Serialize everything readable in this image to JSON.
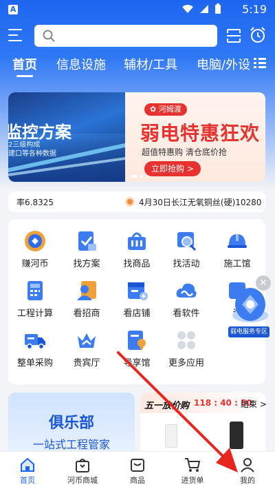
{
  "status_bar": {
    "app_badge": "A",
    "time": "5:19"
  },
  "search": {
    "placeholder": "",
    "value": ""
  },
  "tabs": [
    {
      "label": "首页",
      "active": true
    },
    {
      "label": "信息设施"
    },
    {
      "label": "辅材/工具"
    },
    {
      "label": "电脑/外设"
    }
  ],
  "banner": {
    "left_title": "监控方案",
    "left_sub_line1": "2三级构成",
    "left_sub_line2": "建口等各种数据",
    "brand": "河姆渡",
    "promo_title": "弱电特惠狂欢",
    "promo_sub": "超值特惠购 清仓底价抢",
    "promo_button": "立即抢购 >"
  },
  "ticker": {
    "rate": "率6.8325",
    "copper": "4月30日长江无氧铜丝(硬)10280"
  },
  "grid": [
    {
      "label": "赚河币",
      "icon": "coin-icon"
    },
    {
      "label": "找方案",
      "icon": "document-check-icon"
    },
    {
      "label": "找商品",
      "icon": "shopping-basket-icon"
    },
    {
      "label": "找活动",
      "icon": "magnifier-icon"
    },
    {
      "label": "施工馆",
      "icon": "helmet-icon"
    },
    {
      "label": "工程计算",
      "icon": "calculator-icon"
    },
    {
      "label": "看招商",
      "icon": "person-card-icon"
    },
    {
      "label": "看店铺",
      "icon": "store-icon"
    },
    {
      "label": "看软件",
      "icon": "cloud-icon"
    },
    {
      "label": "资",
      "icon": "resource-icon"
    },
    {
      "label": "整单采购",
      "icon": "truck-icon"
    },
    {
      "label": "贵宾厅",
      "icon": "crown-icon"
    },
    {
      "label": "导享馆",
      "icon": "badge-doc-icon"
    },
    {
      "label": "更多应用",
      "icon": "grid-dots-icon"
    }
  ],
  "float_ad": {
    "label": "弱电服务专区"
  },
  "club": {
    "title": "俱乐部",
    "subtitle": "一站式工程管家"
  },
  "flash_sale": {
    "title": "五一放价购",
    "countdown": "118 : 40 : 50",
    "end_label": "结束 >"
  },
  "bottom_nav": [
    {
      "label": "首页",
      "active": true,
      "icon": "home-icon"
    },
    {
      "label": "河币商城",
      "icon": "shop-bag-icon"
    },
    {
      "label": "商品",
      "icon": "inbox-icon"
    },
    {
      "label": "进货单",
      "icon": "cart-icon"
    },
    {
      "label": "我的",
      "icon": "user-icon"
    }
  ],
  "colors": {
    "primary": "#1e66f0",
    "promo_red": "#e8322f",
    "annotation_arrow": "#e8251f"
  }
}
